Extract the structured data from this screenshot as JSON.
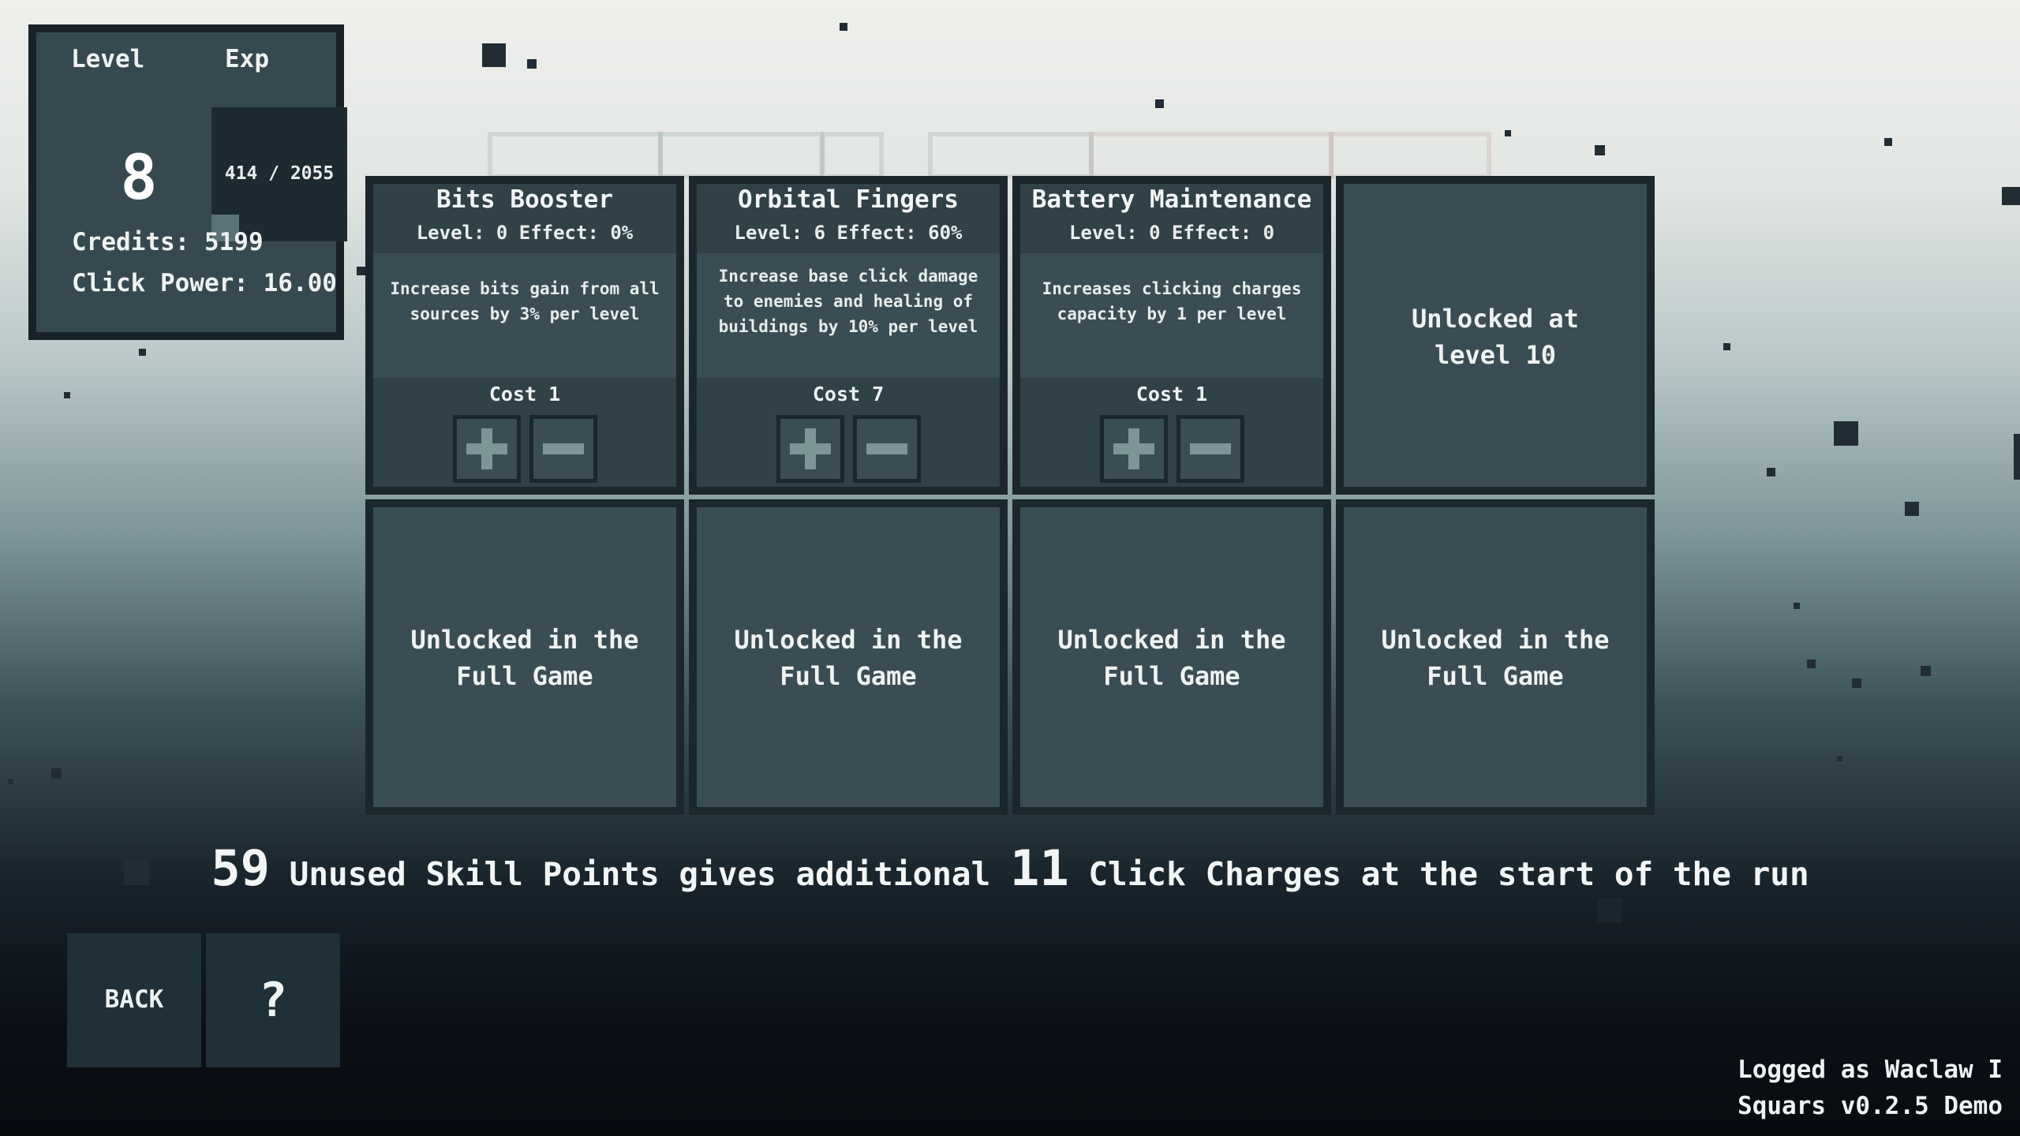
{
  "stats": {
    "level_label": "Level",
    "exp_label": "Exp",
    "level": "8",
    "exp_text": "414 / 2055",
    "exp_fraction": 0.2015,
    "credits_text": "Credits: 5199",
    "click_power_text": "Click Power: 16.00"
  },
  "skills": [
    {
      "title": "Bits Booster",
      "stats": "Level: 0 Effect: 0%",
      "description": "Increase bits gain from all sources by 3% per level",
      "cost": "Cost 1",
      "plus_icon": "plus-icon",
      "minus_icon": "minus-icon"
    },
    {
      "title": "Orbital Fingers",
      "stats": "Level: 6 Effect: 60%",
      "description": "Increase base click damage to enemies and healing of buildings by 10% per level",
      "cost": "Cost 7",
      "plus_icon": "plus-icon",
      "minus_icon": "minus-icon"
    },
    {
      "title": "Battery Maintenance",
      "stats": "Level: 0 Effect: 0",
      "description": "Increases clicking charges capacity by 1 per level",
      "cost": "Cost 1",
      "plus_icon": "plus-icon",
      "minus_icon": "minus-icon"
    }
  ],
  "locked_slots": {
    "level_locked": "Unlocked at level 10",
    "full_game_1": "Unlocked in the Full Game",
    "full_game_2": "Unlocked in the Full Game",
    "full_game_3": "Unlocked in the Full Game",
    "full_game_4": "Unlocked in the Full Game"
  },
  "message": {
    "points": "59",
    "part1": "Unused Skill Points gives additional",
    "charges": "11",
    "part2": "Click Charges at the start of the run"
  },
  "nav": {
    "back_label": "BACK",
    "help_label": "?"
  },
  "footer": {
    "logged_as": "Logged as Waclaw I",
    "version": "Squars v0.2.5 Demo"
  },
  "colors": {
    "panel_dark": "#1c262d",
    "panel_face": "#3b4d54",
    "button_icon": "#7d9597"
  }
}
